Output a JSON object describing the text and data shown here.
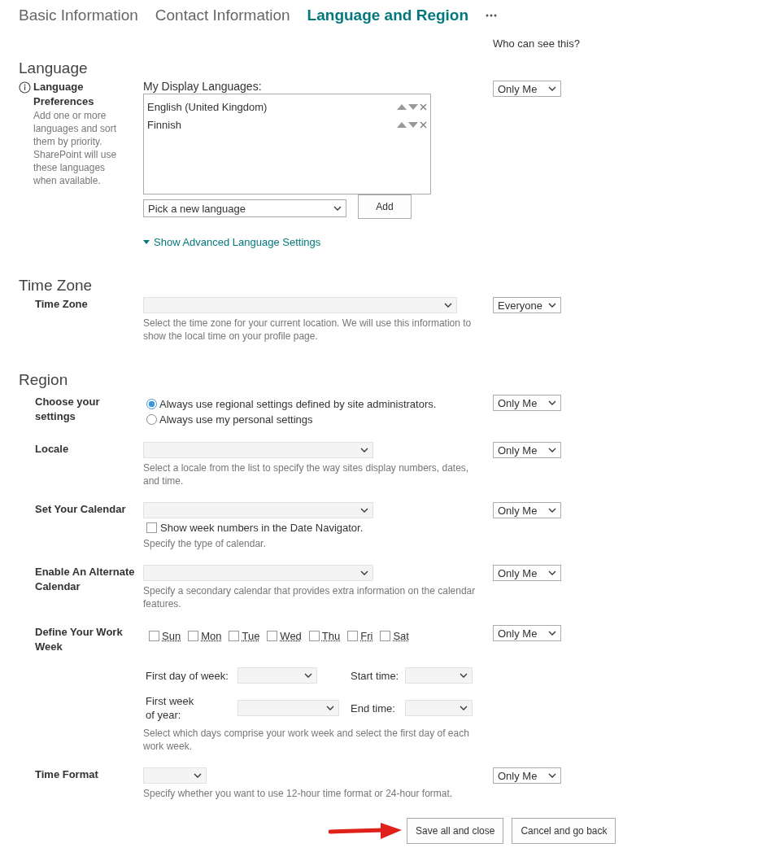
{
  "tabs": [
    {
      "label": "Basic Information",
      "selected": false
    },
    {
      "label": "Contact Information",
      "selected": false
    },
    {
      "label": "Language and Region",
      "selected": true
    }
  ],
  "visibility_header": "Who can see this?",
  "sections": [
    {
      "heading": "Language",
      "rows": [
        {
          "kind": "languages",
          "label": "Language Preferences",
          "description": "Add one or more languages and sort them by priority. SharePoint will use these languages when available.",
          "list_label": "My Display Languages:",
          "languages": [
            "English (United Kingdom)",
            "Finnish"
          ],
          "picker": "Pick a new language",
          "add_button": "Add",
          "advanced_link": "Show Advanced Language Settings",
          "visibility": "Only Me"
        }
      ]
    },
    {
      "heading": "Time Zone",
      "rows": [
        {
          "kind": "select",
          "label": "Time Zone",
          "help": "Select the time zone for your current location. We will use this information to show the local time on your profile page.",
          "visibility": "Everyone"
        }
      ]
    },
    {
      "heading": "Region",
      "rows": [
        {
          "kind": "radios",
          "label": "Choose your settings",
          "options": [
            {
              "label": "Always use regional settings defined by site administrators.",
              "selected": true
            },
            {
              "label": "Always use my personal settings",
              "selected": false
            }
          ],
          "visibility": "Only Me"
        },
        {
          "kind": "select",
          "label": "Locale",
          "help": "Select a locale from the list to specify the way sites display numbers, dates, and time.",
          "visibility": "Only Me"
        },
        {
          "kind": "select",
          "label": "Set Your Calendar",
          "checkbox": {
            "label": "Show week numbers in the Date Navigator.",
            "checked": false
          },
          "help": "Specify the type of calendar.",
          "visibility": "Only Me"
        },
        {
          "kind": "select",
          "label": "Enable An Alternate Calendar",
          "help": "Specify a secondary calendar that provides extra information on the calendar features.",
          "visibility": "Only Me"
        },
        {
          "kind": "workweek",
          "label": "Define Your Work Week",
          "days": [
            {
              "label": "Sun",
              "checked": false
            },
            {
              "label": "Mon",
              "checked": false
            },
            {
              "label": "Tue",
              "checked": false
            },
            {
              "label": "Wed",
              "checked": false
            },
            {
              "label": "Thu",
              "checked": false
            },
            {
              "label": "Fri",
              "checked": false
            },
            {
              "label": "Sat",
              "checked": false
            }
          ],
          "fields": [
            {
              "label": "First day of week:"
            },
            {
              "label": "Start time:"
            },
            {
              "label": "First week of year:"
            },
            {
              "label": "End time:"
            }
          ],
          "help": "Select which days comprise your work week and select the first day of each work week.",
          "visibility": "Only Me"
        },
        {
          "kind": "select",
          "label": "Time Format",
          "help": "Specify whether you want to use 12-hour time format or 24-hour format.",
          "visibility": "Only Me"
        }
      ]
    }
  ],
  "buttons": [
    "Save all and close",
    "Cancel and go back"
  ]
}
